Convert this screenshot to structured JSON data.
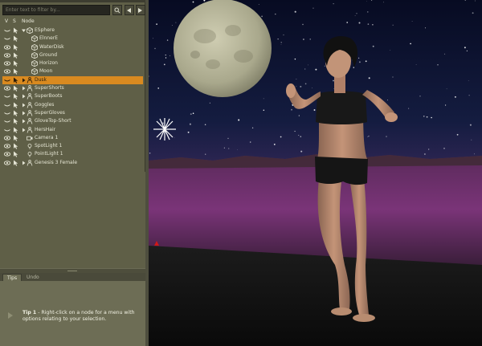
{
  "scene_panel": {
    "search_placeholder": "Enter text to filter by...",
    "columns": {
      "visible": "V",
      "selectable": "S",
      "node": "Node"
    },
    "nodes": [
      {
        "label": "ESphere",
        "type": "group",
        "indent": 0,
        "expander": "expanded",
        "visible": false,
        "selected": false
      },
      {
        "label": "ElnnerE",
        "type": "prop",
        "indent": 1,
        "expander": "none",
        "visible": false,
        "selected": false
      },
      {
        "label": "WaterDisk",
        "type": "prop",
        "indent": 1,
        "expander": "none",
        "visible": true,
        "selected": false
      },
      {
        "label": "Ground",
        "type": "prop",
        "indent": 1,
        "expander": "none",
        "visible": true,
        "selected": false
      },
      {
        "label": "Horizon",
        "type": "prop",
        "indent": 1,
        "expander": "none",
        "visible": true,
        "selected": false
      },
      {
        "label": "Moon",
        "type": "prop",
        "indent": 1,
        "expander": "none",
        "visible": true,
        "selected": false
      },
      {
        "label": "Dusk",
        "type": "figure",
        "indent": 0,
        "expander": "collapsed",
        "visible": false,
        "selected": true
      },
      {
        "label": "SuperShorts",
        "type": "figure",
        "indent": 0,
        "expander": "collapsed",
        "visible": true,
        "selected": false
      },
      {
        "label": "SuperBoots",
        "type": "figure",
        "indent": 0,
        "expander": "collapsed",
        "visible": false,
        "selected": false
      },
      {
        "label": "Goggles",
        "type": "figure",
        "indent": 0,
        "expander": "collapsed",
        "visible": false,
        "selected": false
      },
      {
        "label": "SuperGloves",
        "type": "figure",
        "indent": 0,
        "expander": "collapsed",
        "visible": false,
        "selected": false
      },
      {
        "label": "GloveTop-Short",
        "type": "figure",
        "indent": 0,
        "expander": "collapsed",
        "visible": false,
        "selected": false
      },
      {
        "label": "HersHair",
        "type": "figure",
        "indent": 0,
        "expander": "collapsed",
        "visible": false,
        "selected": false
      },
      {
        "label": "Camera 1",
        "type": "camera",
        "indent": 0,
        "expander": "none",
        "visible": true,
        "selected": false
      },
      {
        "label": "SpotLight 1",
        "type": "light",
        "indent": 0,
        "expander": "none",
        "visible": true,
        "selected": false
      },
      {
        "label": "PointLight 1",
        "type": "light",
        "indent": 0,
        "expander": "none",
        "visible": true,
        "selected": false
      },
      {
        "label": "Genesis 3 Female",
        "type": "figure",
        "indent": 0,
        "expander": "collapsed",
        "visible": true,
        "selected": false
      }
    ]
  },
  "tabs": [
    {
      "label": "Tips",
      "active": true
    },
    {
      "label": "Undo",
      "active": false
    }
  ],
  "tip": {
    "number_label": "Tip 1",
    "text": " - Right-click on a node for a menu with options relating to your selection."
  },
  "colors": {
    "panel": "#5f5f47",
    "selection": "#d98a20",
    "sky": "#0d1430",
    "mountains": "#6a2c6a",
    "ground": "#141414",
    "moon": "#b8b69a"
  },
  "icons": {
    "search": "search-icon",
    "previous": "chevron-left-icon",
    "next": "chevron-right-icon",
    "visible": "eye-icon",
    "hidden": "eye-closed-icon",
    "selectable": "cursor-icon",
    "tip": "play-arrow-icon"
  }
}
